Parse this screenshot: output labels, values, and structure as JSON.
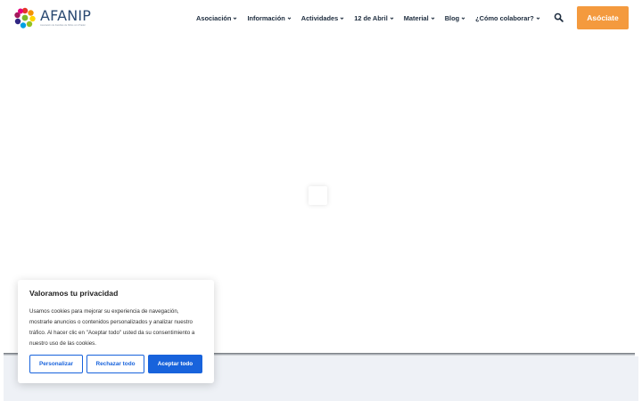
{
  "header": {
    "logo": {
      "name": "AFANIP",
      "subtitle": "Asociación de Familias de Niños con Prader"
    },
    "nav": [
      {
        "label": "Asociación",
        "has_dropdown": true
      },
      {
        "label": "Información",
        "has_dropdown": true
      },
      {
        "label": "Actividades",
        "has_dropdown": true
      },
      {
        "label": "12 de Abril",
        "has_dropdown": true
      },
      {
        "label": "Material",
        "has_dropdown": true
      },
      {
        "label": "Blog",
        "has_dropdown": true
      },
      {
        "label": "¿Cómo colaborar?",
        "has_dropdown": true
      }
    ],
    "search_icon": "search-icon",
    "join_label": "Asóciate"
  },
  "main": {
    "loader_icon": "loading-spinner"
  },
  "cookie_banner": {
    "title": "Valoramos tu privacidad",
    "body": "Usamos cookies para mejorar su experiencia de navegación, mostrarle anuncios o contenidos personalizados y analizar nuestro tráfico. Al hacer clic en \"Aceptar todo\" usted da su consentimiento a nuestro uso de las cookies.",
    "customize_label": "Personalizar",
    "reject_label": "Rechazar todo",
    "accept_label": "Aceptar todo"
  },
  "colors": {
    "accent_orange": "#f49a3e",
    "cookie_blue": "#1863dc",
    "nav_text": "#1c2b3d",
    "footer_band": "#eef1f6"
  }
}
